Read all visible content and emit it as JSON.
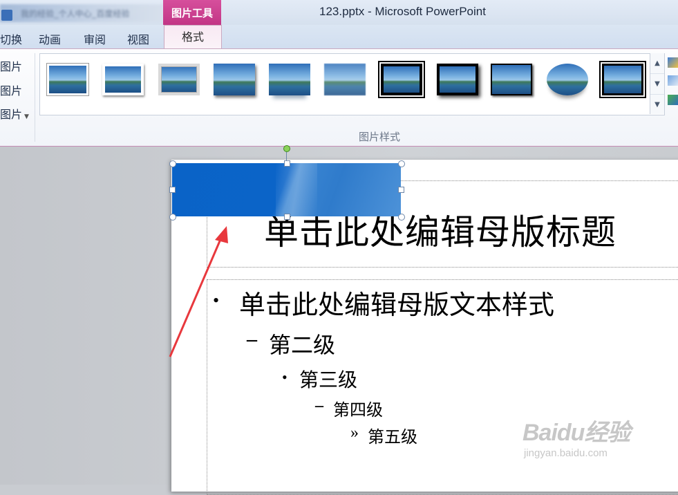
{
  "window": {
    "title": "123.pptx - Microsoft PowerPoint",
    "context_tab": "图片工具",
    "blurred_text": "我的经验_个人中心_百度经验"
  },
  "tabs": [
    {
      "label": "切换"
    },
    {
      "label": "动画"
    },
    {
      "label": "审阅"
    },
    {
      "label": "视图"
    },
    {
      "label": "格式",
      "active": true
    }
  ],
  "ribbon": {
    "left_commands": [
      "图片",
      "图片",
      "图片"
    ],
    "picture_styles": [
      {
        "name": "simple-frame-white"
      },
      {
        "name": "soft-edge-white-frame"
      },
      {
        "name": "thick-matte-grey"
      },
      {
        "name": "drop-shadow-rectangle"
      },
      {
        "name": "reflected-rectangle"
      },
      {
        "name": "soft-edge-rectangle"
      },
      {
        "name": "double-frame-black"
      },
      {
        "name": "thick-matte-black"
      },
      {
        "name": "simple-frame-black"
      },
      {
        "name": "reflected-oval"
      },
      {
        "name": "metal-frame"
      }
    ],
    "group_label": "图片样式"
  },
  "slide": {
    "title": "单击此处编辑母版标题",
    "levels": [
      {
        "bullet": "•",
        "text": "单击此处编辑母版文本样式"
      },
      {
        "bullet": "–",
        "text": "第二级"
      },
      {
        "bullet": "•",
        "text": "第三级"
      },
      {
        "bullet": "–",
        "text": "第四级"
      },
      {
        "bullet": "»",
        "text": "第五级"
      }
    ]
  },
  "colors": {
    "context_tab": "#c23585",
    "picture_fill": "#0b64c8",
    "annotation_arrow": "#e8383d"
  },
  "watermark": {
    "main": "Baidu经验",
    "sub": "jingyan.baidu.com"
  }
}
